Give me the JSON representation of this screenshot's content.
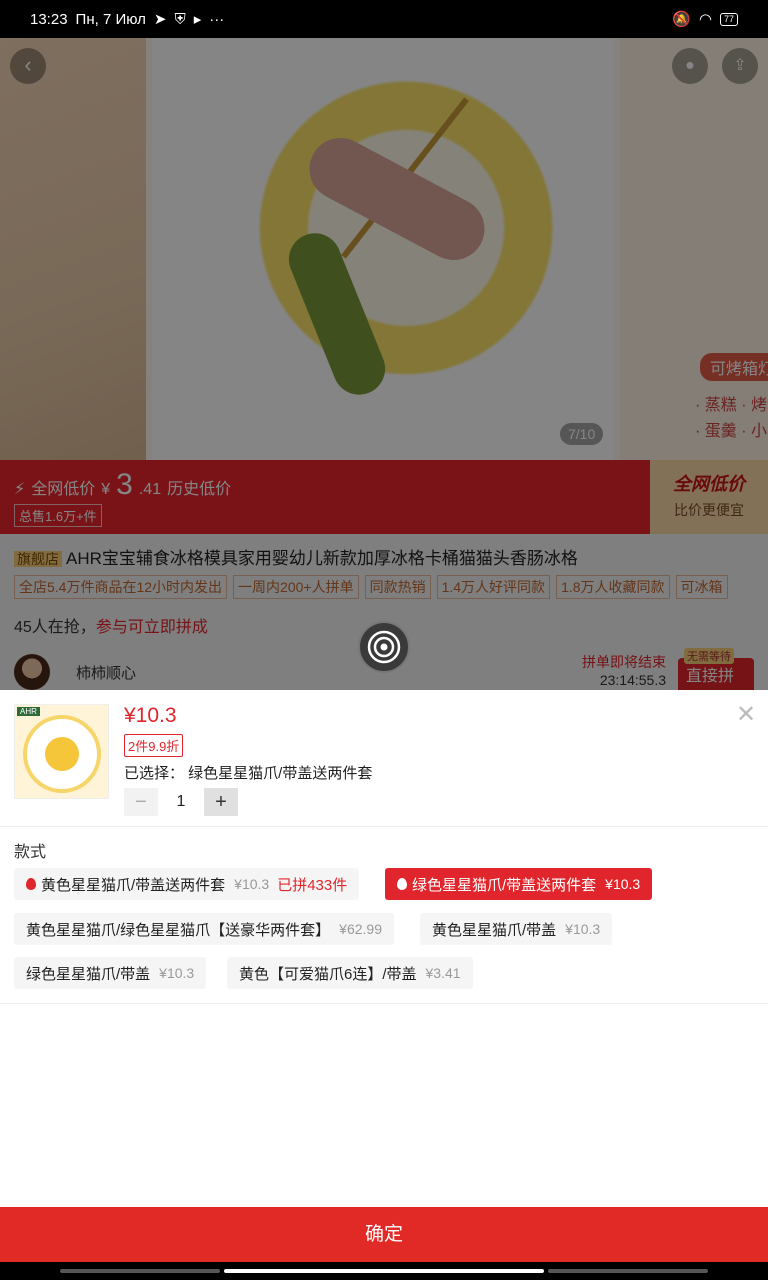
{
  "status_bar": {
    "time": "13:23",
    "date": "Пн, 7 Июл",
    "more": "···",
    "battery": "77"
  },
  "gallery": {
    "counter": "7/10",
    "right_tag": "可烤箱灯",
    "right_lines": [
      "· 蒸糕 · 烤",
      "· 蛋羹 · 小"
    ]
  },
  "price_banner": {
    "label": "全网低价",
    "currency": "¥",
    "price_int": "3",
    "price_dec": ".41",
    "history": "历史低价",
    "sold": "总售1.6万+件",
    "badge_title": "全网低价",
    "badge_sub": "比价更便宜"
  },
  "product": {
    "flag": "旗舰店",
    "title": "AHR宝宝辅食冰格模具家用婴幼儿新款加厚冰格卡桶猫猫头香肠冰格",
    "chips": [
      "全店5.4万件商品在12小时内发出",
      "一周内200+人拼单",
      "同款热销",
      "1.4万人好评同款",
      "1.8万人收藏同款",
      "可冰箱"
    ],
    "grab_count": "45人在抢，",
    "grab_link": "参与可立即拼成"
  },
  "group": {
    "user": "柿柿顺心",
    "ending": "拼单即将结束",
    "timer": "23:14:55.3",
    "no_wait": "无需等待",
    "join": "直接拼成"
  },
  "sheet": {
    "thumb_brand": "AHR",
    "price": "¥10.3",
    "discount": "2件9.9折",
    "selected": "已选择： 绿色星星猫爪/带盖送两件套",
    "quantity": "1",
    "minus": "−",
    "plus": "+",
    "close": "✕",
    "section": "款式",
    "options": [
      {
        "label": "黄色星星猫爪/带盖送两件套",
        "price": "¥10.3",
        "extra": "已拼433件",
        "selected": false,
        "hot": true
      },
      {
        "label": "绿色星星猫爪/带盖送两件套",
        "price": "¥10.3",
        "selected": true,
        "hot": true
      },
      {
        "label": "黄色星星猫爪/绿色星星猫爪【送豪华两件套】",
        "price": "¥62.99",
        "selected": false
      },
      {
        "label": "黄色星星猫爪/带盖",
        "price": "¥10.3",
        "selected": false
      },
      {
        "label": "绿色星星猫爪/带盖",
        "price": "¥10.3",
        "selected": false
      },
      {
        "label": "黄色【可爱猫爪6连】/带盖",
        "price": "¥3.41",
        "selected": false
      }
    ],
    "confirm": "确定"
  },
  "colors": {
    "accent_red": "#e0262c",
    "overlay": "rgba(0,0,0,0.48)"
  }
}
